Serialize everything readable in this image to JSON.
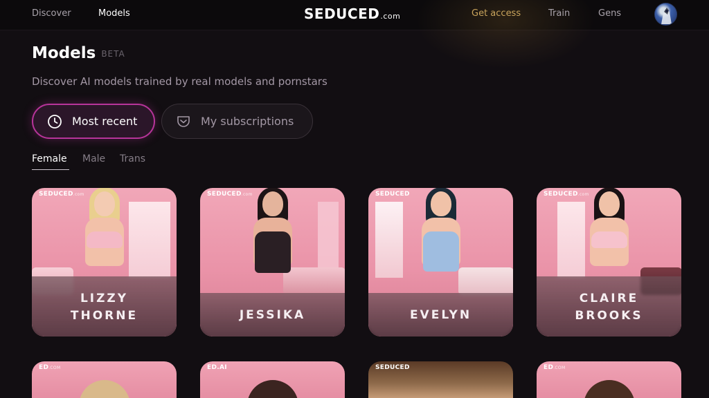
{
  "nav": {
    "discover": "Discover",
    "models": "Models",
    "get_access": "Get access",
    "train": "Train",
    "gens": "Gens"
  },
  "logo": {
    "main": "SEDUCED",
    "suffix": ".com"
  },
  "header": {
    "title": "Models",
    "badge": "BETA",
    "subtitle": "Discover AI models trained by real models and pornstars"
  },
  "filters": {
    "recent_label": "Most recent",
    "subscriptions_label": "My subscriptions"
  },
  "gender_tabs": [
    "Female",
    "Male",
    "Trans"
  ],
  "cards": [
    {
      "name": "LIZZY\nTHORNE",
      "watermark": "SEDUCED",
      "watermark_suffix": ".com"
    },
    {
      "name": "JESSIKA",
      "watermark": "SEDUCED",
      "watermark_suffix": ".com"
    },
    {
      "name": "EVELYN",
      "watermark": "SEDUCED",
      "watermark_suffix": ""
    },
    {
      "name": "CLAIRE\nBROOKS",
      "watermark": "SEDUCED",
      "watermark_suffix": ".com"
    }
  ],
  "row2_watermarks": [
    {
      "text": "ED",
      "suffix": ".COM"
    },
    {
      "text": "ED.AI",
      "suffix": ""
    },
    {
      "text": "SEDUCED",
      "suffix": ""
    },
    {
      "text": "ED",
      "suffix": ".COM"
    }
  ],
  "colors": {
    "background": "#120e12",
    "accent_gold": "#c9a45c",
    "accent_pink": "#b7349a"
  }
}
